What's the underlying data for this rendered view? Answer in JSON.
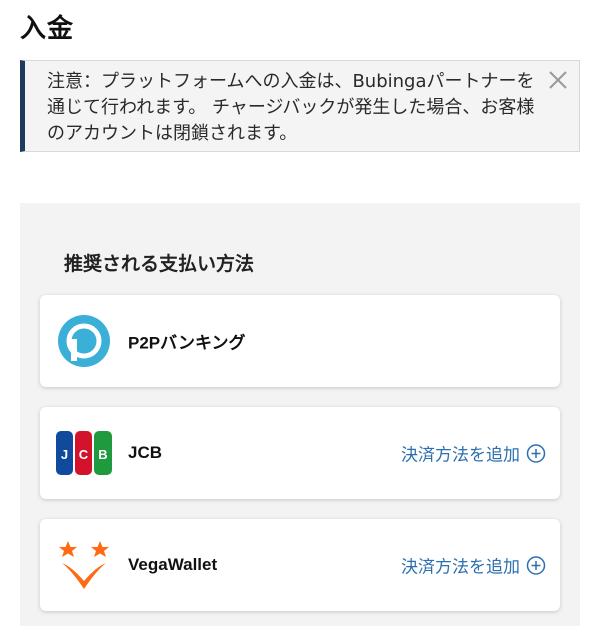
{
  "page": {
    "title": "入金"
  },
  "notice": {
    "text": "注意：プラットフォームへの入金は、Bubingaパートナーを通じて行われます。 チャージバックが発生した場合、お客様のアカウントは閉鎖されます。",
    "accent_color": "#1f3a5f"
  },
  "payment_methods": {
    "heading": "推奨される支払い方法",
    "add_label": "決済方法を追加",
    "items": [
      {
        "name": "P2Pバンキング",
        "icon": "p2p-logo-icon",
        "has_add": false
      },
      {
        "name": "JCB",
        "icon": "jcb-logo-icon",
        "has_add": true
      },
      {
        "name": "VegaWallet",
        "icon": "vegawallet-logo-icon",
        "has_add": true
      }
    ]
  },
  "colors": {
    "link": "#2b6fb0",
    "p2p_brand": "#3ab0d8",
    "vega_orange": "#ff6a13"
  }
}
